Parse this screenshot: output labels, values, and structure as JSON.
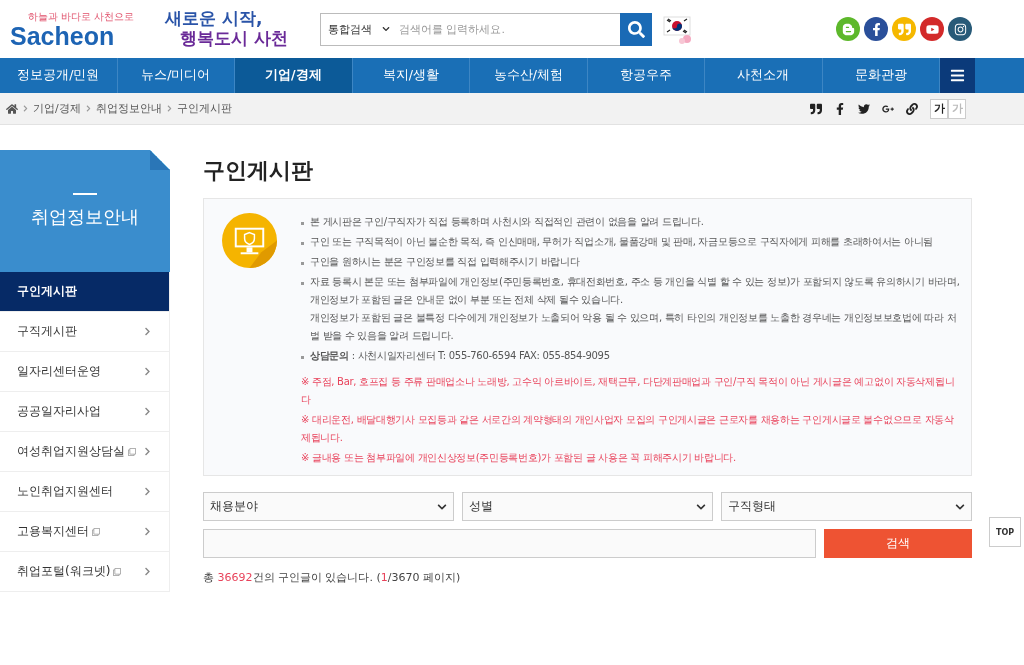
{
  "header": {
    "logo": {
      "tagline": "하늘과 바다로 사천으로",
      "name": "Sacheon"
    },
    "slogan": [
      "새로운 시작,",
      "행복도시 사천"
    ],
    "search": {
      "scope": "통합검색",
      "placeholder": "검색어를 입력하세요."
    }
  },
  "nav": {
    "items": [
      {
        "label": "정보공개/민원",
        "selected": false
      },
      {
        "label": "뉴스/미디어",
        "selected": false
      },
      {
        "label": "기업/경제",
        "selected": true
      },
      {
        "label": "복지/생활",
        "selected": false
      },
      {
        "label": "농수산/체험",
        "selected": false
      },
      {
        "label": "항공우주",
        "selected": false
      },
      {
        "label": "사천소개",
        "selected": false
      },
      {
        "label": "문화관광",
        "selected": false
      }
    ]
  },
  "breadcrumb": {
    "items": [
      "기업/경제",
      "취업정보안내",
      "구인게시판"
    ],
    "font_sizes": [
      {
        "label": "가",
        "selected": true
      },
      {
        "label": "가",
        "selected": false
      }
    ]
  },
  "sidebar": {
    "title": "취업정보안내",
    "items": [
      {
        "label": "구인게시판",
        "selected": true,
        "external": false
      },
      {
        "label": "구직게시판",
        "selected": false,
        "external": false
      },
      {
        "label": "일자리센터운영",
        "selected": false,
        "external": false
      },
      {
        "label": "공공일자리사업",
        "selected": false,
        "external": false
      },
      {
        "label": "여성취업지원상담실",
        "selected": false,
        "external": true
      },
      {
        "label": "노인취업지원센터",
        "selected": false,
        "external": false
      },
      {
        "label": "고용복지센터",
        "selected": false,
        "external": true
      },
      {
        "label": "취업포털(워크넷)",
        "selected": false,
        "external": true
      }
    ]
  },
  "page_title": "구인게시판",
  "notice": {
    "bullets": [
      [
        "본 게시판은 구인/구직자가 직접 등록하며 사천시와 직접적인 관련이 없음을 알려 드립니다."
      ],
      [
        "구인 또는 구직목적이 아닌 불순한 목적, 즉 인신매매, 무허가 직업소개, 물품강매 및 판매, 자금모등으로 구직자에게 피해를 초래하여서는 아니됨"
      ],
      [
        "구인을 원하시는 분은 구인정보를 직접 입력해주시기 바랍니다"
      ],
      [
        "자료 등록시 본문 또는 첨부파일에 개인정보(주민등록번호, 휴대전화번호, 주소 등 개인을 식별 할 수 있는 정보)가 포함되지 않도록 유의하시기 바라며, 개인정보가 포함된 글은 안내문 없이 부분 또는 전체 삭제 될수 있습니다.",
        "개인정보가 포함된 글은 불특정 다수에게 개인정보가 노출되어 악용 될 수 있으며, 특히 타인의 개인정보를 노출한 경우네는 개인정보보호법에 따라 처벌 받을 수 있음을 알려 드립니다."
      ],
      [
        "**상담문의** : 사천시일자리센터 T: 055-760-6594 FAX: 055-854-9095"
      ]
    ],
    "warnings": [
      "※ 주점, Bar, 호프집 등 주류 판매업소나 노래방, 고수익 아르바이트, 재택근무, 다단계판매업과 구인/구직 목적이 아닌 게시글은 예고없이 자동삭제됩니다",
      "※ 대리운전, 배달대행기사 모집등과 같은 서로간의 계약형태의 개인사업자 모집의 구인게시글은 근로자를 채용하는 구인게시글로 볼수없으므로 자동삭제됩니다.",
      "※ 글내용 또는 첨부파일에 개인신상정보(주민등록번호)가 포함된 글 사용은 꼭 피해주시기 바랍니다."
    ]
  },
  "filters": {
    "selects": [
      "채용분야",
      "성별",
      "구직형태"
    ],
    "search_button": "검색"
  },
  "count": [
    {
      "text": "총 ",
      "highlight": false
    },
    {
      "text": "36692",
      "highlight": true
    },
    {
      "text": "건의 구인글이 있습니다. (",
      "highlight": false
    },
    {
      "text": "1",
      "highlight": true
    },
    {
      "text": "/3670 페이지)",
      "highlight": false
    }
  ],
  "top_button": "TOP"
}
